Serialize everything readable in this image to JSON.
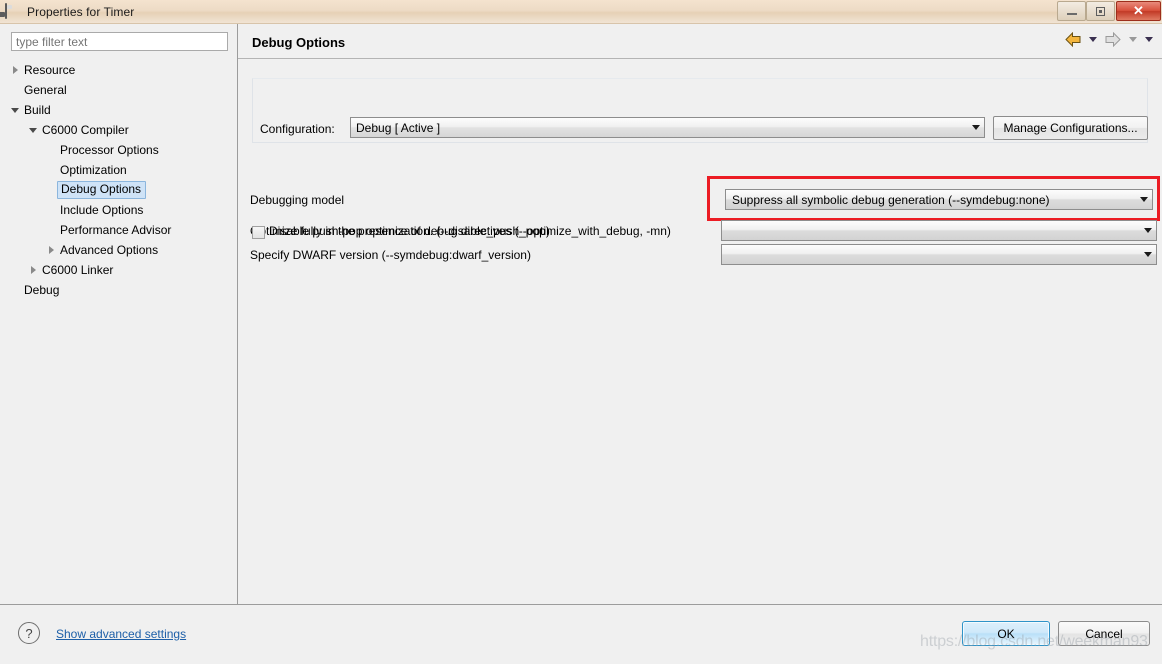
{
  "window": {
    "title": "Properties for Timer",
    "icon": "cube-icon",
    "minimize_label": "minimize-icon",
    "maximize_label": "maximize-icon",
    "close_label": "✕"
  },
  "filter": {
    "placeholder": "type filter text",
    "value": ""
  },
  "tree": {
    "items": [
      {
        "label": "Resource",
        "indent": 0,
        "twisty": "right",
        "selected": false
      },
      {
        "label": "General",
        "indent": 0,
        "twisty": "none",
        "selected": false
      },
      {
        "label": "Build",
        "indent": 0,
        "twisty": "down",
        "selected": false
      },
      {
        "label": "C6000 Compiler",
        "indent": 1,
        "twisty": "down",
        "selected": false
      },
      {
        "label": "Processor Options",
        "indent": 2,
        "twisty": "none",
        "selected": false
      },
      {
        "label": "Optimization",
        "indent": 2,
        "twisty": "none",
        "selected": false
      },
      {
        "label": "Debug Options",
        "indent": 2,
        "twisty": "none",
        "selected": true
      },
      {
        "label": "Include Options",
        "indent": 2,
        "twisty": "none",
        "selected": false
      },
      {
        "label": "Performance Advisor",
        "indent": 2,
        "twisty": "none",
        "selected": false
      },
      {
        "label": "Advanced Options",
        "indent": 2,
        "twisty": "right",
        "selected": false
      },
      {
        "label": "C6000 Linker",
        "indent": 1,
        "twisty": "right",
        "selected": false
      },
      {
        "label": "Debug",
        "indent": 0,
        "twisty": "none",
        "selected": false
      }
    ]
  },
  "page": {
    "title": "Debug Options",
    "nav": {
      "back_icon": "back-arrow-icon",
      "back_menu_icon": "chevron-down-icon",
      "forward_icon": "forward-arrow-icon",
      "forward_menu_icon": "chevron-down-icon",
      "view_menu_icon": "chevron-down-icon"
    }
  },
  "configuration": {
    "label": "Configuration:",
    "value": "Debug  [ Active ]",
    "dropdown_icon": "chevron-down-icon",
    "manage_button": "Manage Configurations..."
  },
  "options": [
    {
      "label": "Debugging model",
      "value": "Suppress all symbolic debug generation (--symdebug:none)",
      "highlighted": true,
      "dropdown_icon": "chevron-down-icon"
    },
    {
      "label": "Optimize fully in the presence of debug directives (--optimize_with_debug, -mn)",
      "value": "",
      "highlighted": false,
      "dropdown_icon": "chevron-down-icon"
    },
    {
      "label": "Specify DWARF version (--symdebug:dwarf_version)",
      "value": "",
      "highlighted": false,
      "dropdown_icon": "chevron-down-icon"
    }
  ],
  "checkbox": {
    "label": "Disable push-pop optimization. (--disable_push_pop)",
    "checked": false
  },
  "footer": {
    "help_icon": "?",
    "advanced_link": "Show advanced settings",
    "ok_button": "OK",
    "cancel_button": "Cancel"
  },
  "watermark": "https://blog.csdn.net/weekman93",
  "colors": {
    "highlight_red": "#ec1c24",
    "selection_blue": "#cfe3f7",
    "link_blue": "#1d5fa8",
    "titlebar": "#eddbc5"
  }
}
